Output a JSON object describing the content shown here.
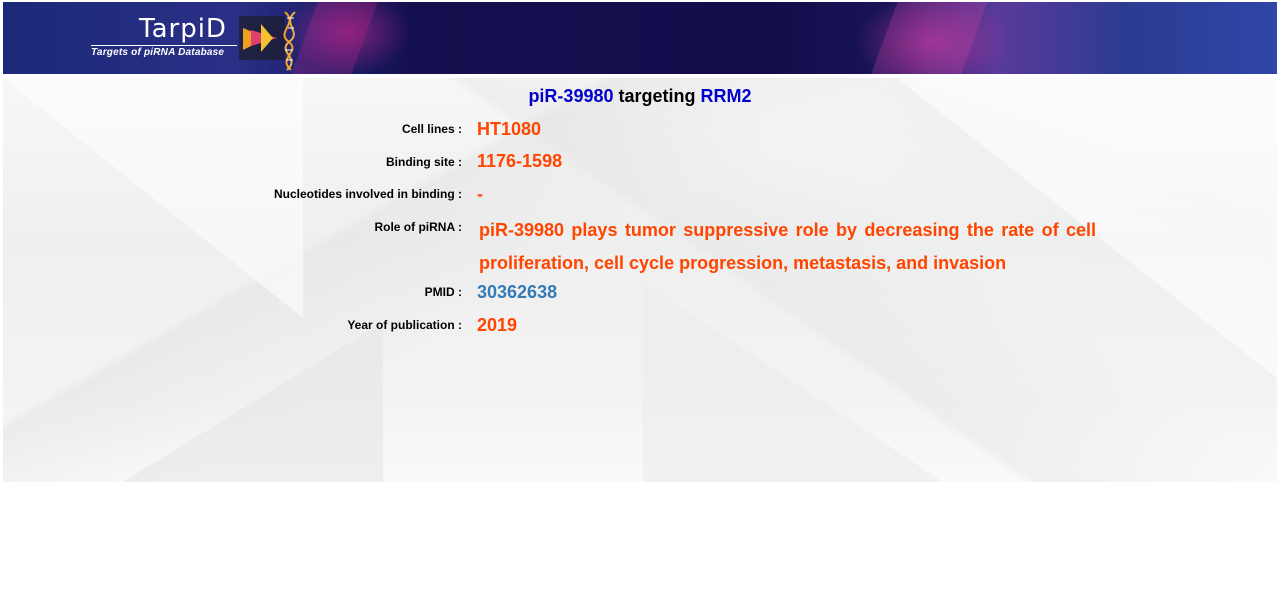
{
  "header": {
    "logo_title": "TarpiD",
    "logo_subtitle": "Targets of piRNA Database",
    "icon": "dna-helix-icon"
  },
  "heading": {
    "pirna": "piR-39980",
    "connector": "targeting",
    "gene": "RRM2"
  },
  "fields": {
    "cell_lines_label": "Cell lines :",
    "cell_lines_value": "HT1080",
    "binding_site_label": "Binding site :",
    "binding_site_value": "1176-1598",
    "nucleotides_label": "Nucleotides involved in binding :",
    "nucleotides_value": "-",
    "role_label": "Role of piRNA :",
    "role_value": "piR-39980 plays tumor suppressive role by decreasing the rate of cell proliferation, cell cycle progression, metastasis, and invasion",
    "pmid_label": "PMID :",
    "pmid_value": "30362638",
    "year_label": "Year of publication :",
    "year_value": "2019"
  },
  "colors": {
    "value": "#ff4500",
    "link": "#337ab7",
    "heading_accent": "#0000cc",
    "banner": "#14104f"
  }
}
